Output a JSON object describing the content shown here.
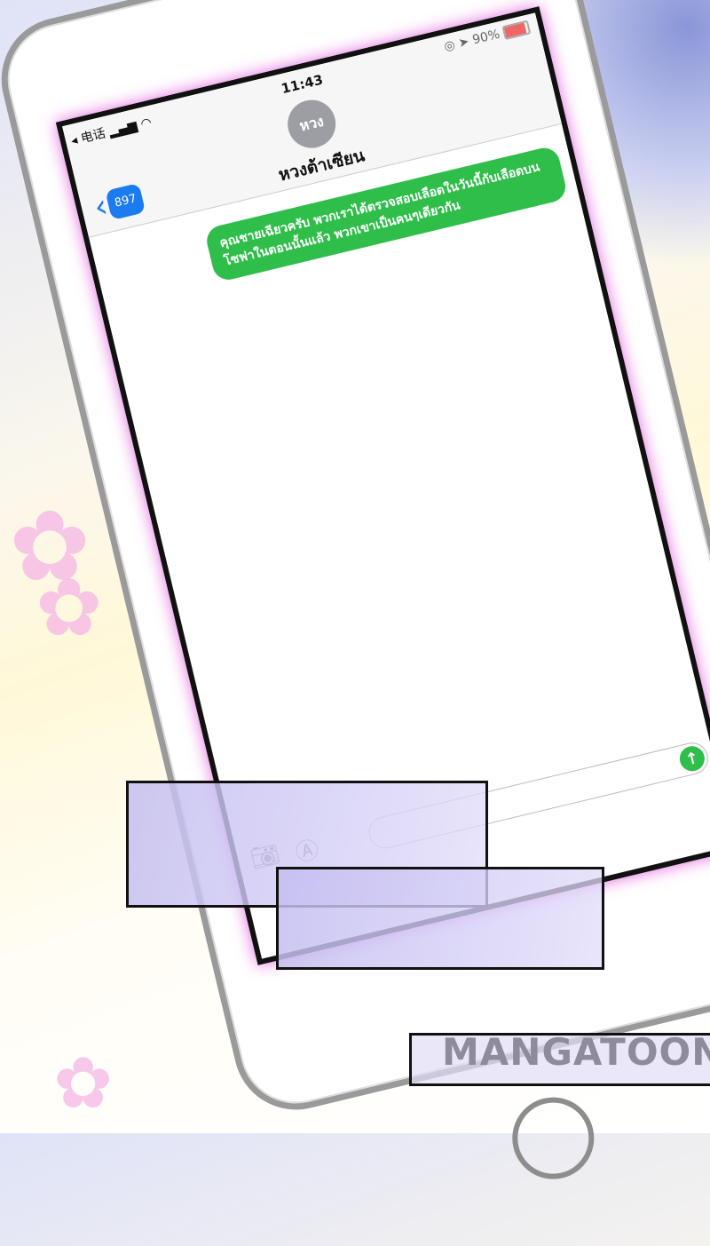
{
  "status_bar": {
    "carrier": "电话",
    "time": "11:43",
    "battery": "90%",
    "battery_level": 0.9
  },
  "header": {
    "back_count": "897",
    "avatar_text": "หวง",
    "contact_name": "หวงต้าเซียน"
  },
  "messages": [
    {
      "direction": "outgoing",
      "text": "คุณชายเฉียวครับ พวกเราได้ตรวจสอบเลือดในวันนี้กับเลือดบนโซฟาในตอนนั้นแล้ว พวกเขาเป็นคนๆเดียวกัน"
    }
  ],
  "input": {
    "send_icon": "arrow-up-icon"
  },
  "toolbar": {
    "icons": [
      "camera-icon",
      "app-store-icon"
    ]
  },
  "watermark": "MANGATOON",
  "colors": {
    "bubble": "#2fbe4a",
    "accent": "#1a7cf0",
    "panel": "#c4bef0"
  }
}
